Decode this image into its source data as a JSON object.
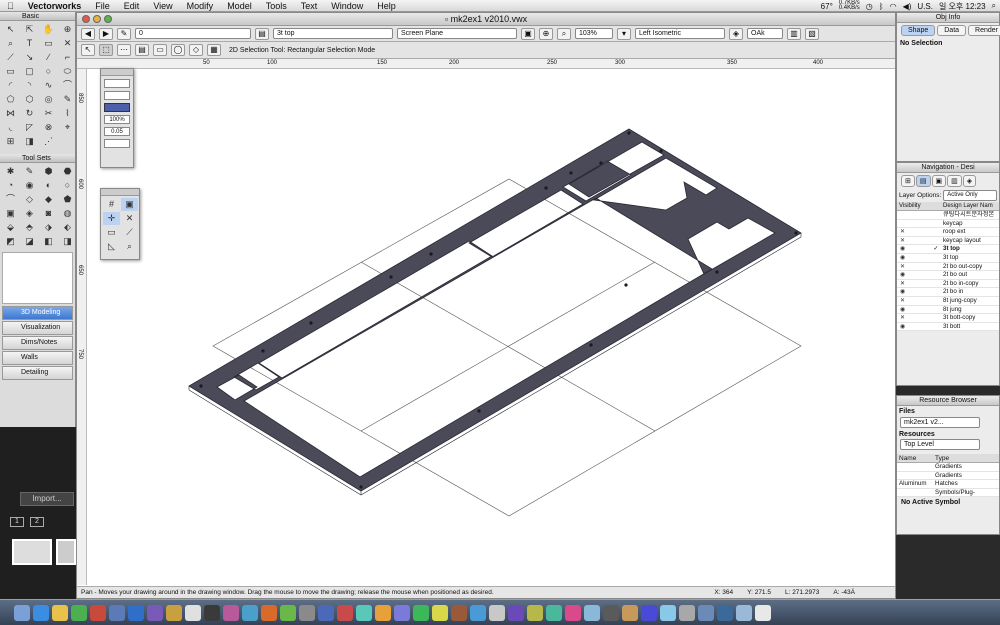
{
  "menubar": {
    "apple_icon": "apple-icon",
    "app_name": "Vectorworks",
    "items": [
      "File",
      "Edit",
      "View",
      "Modify",
      "Model",
      "Tools",
      "Text",
      "Window",
      "Help"
    ],
    "battery": "67°",
    "net_up": "0.7KB/s",
    "net_down": "0.4KB/s",
    "input_source": "U.S.",
    "clock": "일 오후 12:23"
  },
  "document": {
    "title": "mk2ex1 v2010.vwx",
    "class_value": "0",
    "layer_value": "3t top",
    "plane_value": "Screen Plane",
    "zoom_value": "103%",
    "view_value": "Left Isometric",
    "render_value": "OAk",
    "mode_hint": "2D Selection Tool: Rectangular Selection Mode",
    "ruler_ticks": [
      "50",
      "100",
      "150",
      "200",
      "250",
      "300",
      "350",
      "400"
    ],
    "vruler_ticks": [
      "850",
      "600",
      "650",
      "750"
    ],
    "status_message": "Pan - Moves your drawing around in the drawing window. Drag the mouse to move the drawing; release the mouse when positioned as desired.",
    "coord_x": "X: 364",
    "coord_y": "Y: 271.5",
    "coord_l": "L: 271.2973",
    "coord_a": "A: -43Ä"
  },
  "basic_palette": {
    "title": "Basic"
  },
  "tool_sets": {
    "title": "Tool Sets",
    "buttons": [
      "3D Modeling",
      "Visualization",
      "Dims/Notes",
      "Walls",
      "Detailing"
    ]
  },
  "attributes_palette": {
    "zoom": "100%",
    "line_weight": "0.05"
  },
  "left_dark": {
    "import_button": "Import...",
    "page_1": "1",
    "page_2": "2"
  },
  "obj_info": {
    "title": "Obj Info",
    "tabs": [
      "Shape",
      "Data",
      "Render"
    ],
    "selection": "No Selection"
  },
  "navigation": {
    "title": "Navigation - Desi",
    "layer_options_label": "Layer Options:",
    "layer_options_value": "Active Only",
    "col_visibility": "Visibility",
    "col_name": "Design Layer Nam",
    "layers": [
      {
        "name": "큐팅다시트문자정본",
        "vis": "",
        "check": ""
      },
      {
        "name": "keycap",
        "vis": "",
        "check": ""
      },
      {
        "name": "roop ext",
        "vis": "✕",
        "check": ""
      },
      {
        "name": "keycap layout",
        "vis": "✕",
        "check": ""
      },
      {
        "name": "3t top",
        "vis": "◉",
        "check": "✓",
        "current": true
      },
      {
        "name": "3t top",
        "vis": "◉",
        "check": ""
      },
      {
        "name": "2t bo out-copy",
        "vis": "✕",
        "check": ""
      },
      {
        "name": "2t bo out",
        "vis": "◉",
        "check": ""
      },
      {
        "name": "2t bo in-copy",
        "vis": "✕",
        "check": ""
      },
      {
        "name": "2t bo in",
        "vis": "◉",
        "check": ""
      },
      {
        "name": "8t jung-copy",
        "vis": "✕",
        "check": ""
      },
      {
        "name": "8t jung",
        "vis": "◉",
        "check": ""
      },
      {
        "name": "3t bott-copy",
        "vis": "✕",
        "check": ""
      },
      {
        "name": "3t bott",
        "vis": "◉",
        "check": ""
      }
    ]
  },
  "resource_browser": {
    "title": "Resource Browser",
    "files_label": "Files",
    "file_value": "mk2ex1 v2...",
    "resources_label": "Resources",
    "level_value": "Top Level",
    "col_name": "Name",
    "col_type": "Type",
    "rows": [
      {
        "name": "",
        "type": "Gradients"
      },
      {
        "name": "",
        "type": "Gradients"
      },
      {
        "name": "Aluminum",
        "type": "Hatches"
      },
      {
        "name": "",
        "type": "Symbols/Plug-"
      }
    ],
    "no_active": "No Active Symbol"
  },
  "colors": {
    "plate_fill": "#4a4a58",
    "plate_stroke": "#2a2a35",
    "accent": "#3f78d1"
  }
}
